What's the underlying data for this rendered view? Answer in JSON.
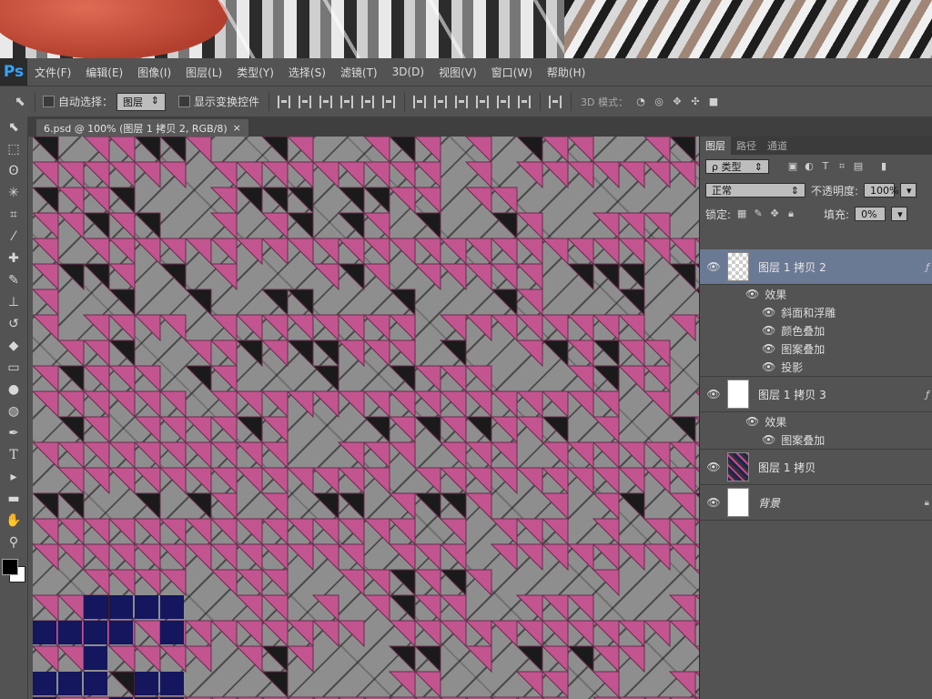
{
  "app": {
    "logo": "Ps"
  },
  "menu": [
    "文件(F)",
    "编辑(E)",
    "图像(I)",
    "图层(L)",
    "类型(Y)",
    "选择(S)",
    "滤镜(T)",
    "3D(D)",
    "视图(V)",
    "窗口(W)",
    "帮助(H)"
  ],
  "options": {
    "auto_select_label": "自动选择：",
    "auto_select_value": "图层",
    "show_transform_label": "显示变换控件",
    "mode_3d_label": "3D 模式："
  },
  "document": {
    "tab_title": "6.psd @ 100% (图层 1 拷贝 2, RGB/8)",
    "tab_close": "×"
  },
  "panel": {
    "tabs": [
      "图层",
      "路径",
      "通道"
    ],
    "filter_value": "ρ 类型",
    "blend_mode": "正常",
    "opacity_label": "不透明度:",
    "opacity_value": "100%",
    "lock_label": "锁定:",
    "fill_label": "填充:",
    "fill_value": "0%"
  },
  "layers": [
    {
      "name": "图层 1 拷贝 2",
      "effects_label": "效果",
      "effects": [
        "斜面和浮雕",
        "颜色叠加",
        "图案叠加",
        "投影"
      ]
    },
    {
      "name": "图层 1 拷贝 3",
      "effects_label": "效果",
      "effects": [
        "图案叠加"
      ]
    },
    {
      "name": "图层 1 拷贝"
    },
    {
      "name": "背景"
    }
  ],
  "colors": {
    "accent_pink": "#c2558f",
    "selected_layer": "#6b7a94",
    "ps_blue": "#33a3ff"
  }
}
